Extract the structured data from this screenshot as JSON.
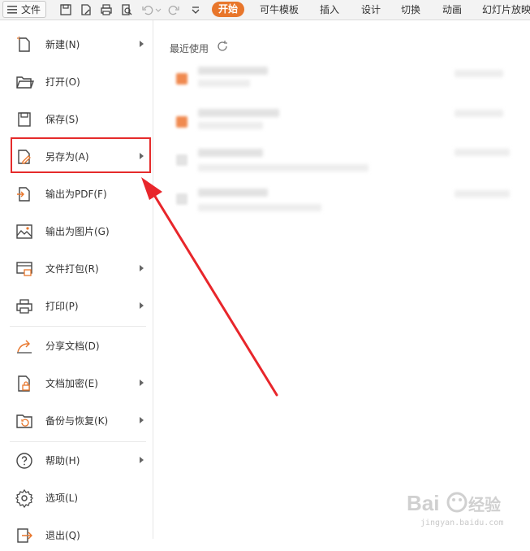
{
  "toolbar": {
    "file_menu_label": "文件",
    "tabs": [
      "开始",
      "可牛模板",
      "插入",
      "设计",
      "切换",
      "动画",
      "幻灯片放映"
    ]
  },
  "menu": {
    "items": [
      {
        "label": "新建(N)",
        "icon": "new-file-icon",
        "submenu": true
      },
      {
        "label": "打开(O)",
        "icon": "folder-open-icon",
        "submenu": false
      },
      {
        "label": "保存(S)",
        "icon": "save-icon",
        "submenu": false
      },
      {
        "label": "另存为(A)",
        "icon": "save-as-icon",
        "submenu": true
      },
      {
        "label": "输出为PDF(F)",
        "icon": "export-pdf-icon",
        "submenu": false
      },
      {
        "label": "输出为图片(G)",
        "icon": "export-image-icon",
        "submenu": false
      },
      {
        "label": "文件打包(R)",
        "icon": "package-icon",
        "submenu": true
      },
      {
        "label": "打印(P)",
        "icon": "printer-icon",
        "submenu": true
      },
      {
        "label": "分享文档(D)",
        "icon": "share-icon",
        "submenu": false
      },
      {
        "label": "文档加密(E)",
        "icon": "encrypt-icon",
        "submenu": true
      },
      {
        "label": "备份与恢复(K)",
        "icon": "backup-icon",
        "submenu": true
      },
      {
        "label": "帮助(H)",
        "icon": "help-icon",
        "submenu": true
      },
      {
        "label": "选项(L)",
        "icon": "gear-icon",
        "submenu": false
      },
      {
        "label": "退出(Q)",
        "icon": "exit-icon",
        "submenu": false
      }
    ]
  },
  "recent": {
    "title": "最近使用"
  },
  "watermark": {
    "url": "jingyan.baidu.com"
  },
  "colors": {
    "accent": "#e8762b",
    "highlight": "#e52b2b"
  }
}
